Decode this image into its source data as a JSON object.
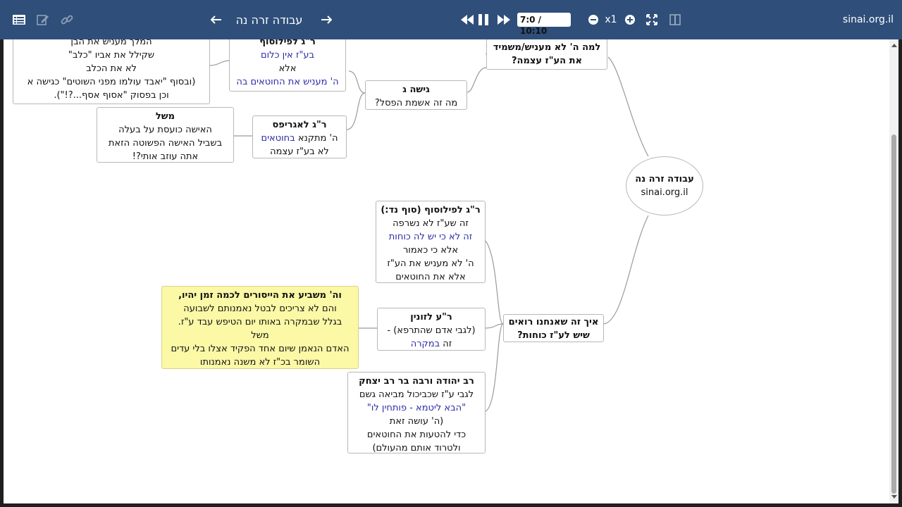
{
  "toolbar": {
    "title": "עבודה זרה נה",
    "time": "7:0 / 10:10",
    "speed": "x1",
    "site": "sinai.org.il",
    "icons": [
      "list-icon",
      "edit-icon",
      "link-icon",
      "arrow-left-icon",
      "arrow-right-icon",
      "rewind-icon",
      "pause-icon",
      "fast-forward-icon",
      "minus-icon",
      "plus-icon",
      "fullscreen-icon",
      "split-view-icon"
    ]
  },
  "colors": {
    "toolbar_bg": "#2f4f7a",
    "link_text": "#2b2ba8",
    "highlight_bg": "#fbf8a6"
  },
  "map": {
    "root": {
      "title": "עבודה זרה נה",
      "subtitle": "sinai.org.il"
    },
    "why_branch": {
      "title": "למה ה' לא מעניש/משמיד",
      "line2": "את הע\"ז עצמה?"
    },
    "approach_g": {
      "title": "גישה ג",
      "text": "מה זה אשמת הפסל?"
    },
    "philosopher_top": {
      "title": "ר\"ג לפילוסוף",
      "l1": "בע\"ז אין כלום",
      "l2": "אלא",
      "l3": "ה' מעניש את החוטאים בה"
    },
    "top_left": {
      "l1": "המלך מעניש את הבן",
      "l2": "שקילל את אביו \"כלב\"",
      "l3": "לא את הכלב",
      "l4": "(ובסוף \"יאבד עולמו מפני השוטים\" כגישה א",
      "l5": "וכן בפסוק \"אסוף אסף...?!\")."
    },
    "agrippas": {
      "title": "ר\"ג לאגריפס",
      "l1a": "ה' מתקנא",
      "l1b": "בחוטאים",
      "l2": "לא בע\"ז עצמה"
    },
    "mashal_top": {
      "title": "משל",
      "l1": "האישה כועסת על בעלה",
      "l2": "בשביל האישה הפשוטה הזאת",
      "l3": "אתה עוזב אותי?!"
    },
    "powers_branch": {
      "title": "איך זה שאנחנו רואים",
      "line2": "שיש לע\"ז כוחות?"
    },
    "philosopher_end": {
      "title": "ר\"ג לפילוסוף (סוף נד:)",
      "l1": "זה שע\"ז לא נשרפה",
      "l2": "זה לא כי יש לה כוחות",
      "l3": "אלא כי כאמור",
      "l4": "ה' לא מעניש את הע\"ז",
      "l5": "אלא את החוטאים"
    },
    "zunin": {
      "title": "ר\"ע לזונין",
      "l1": "(לגבי אדם שהתרפא) -",
      "l2a": "זה",
      "l2b": "במקרה"
    },
    "oath_note": {
      "title": "וה' משביע את הייסורים לכמה זמן יהיו,",
      "l1": "והם לא צריכים לבטל נאמנותם לשבועה",
      "l2": "בגלל שבמקרה באותו יום הטיפש עבד ע\"ז.",
      "l3": "משל",
      "l4": "האדם הנאמן שיום אחד הפקיד אצלו בלי עדים",
      "l5": "השומר בכ\"ז לא משנה נאמנותו"
    },
    "rav_yehuda": {
      "title": "רב יהודה ורבה בר רב יצחק",
      "l1": "לגבי ע\"ז שכביכול מביאה גשם",
      "l2": "\"הבא ליטמא - פותחין לו\"",
      "l3": "(ה' עושה זאת",
      "l4": "כדי להטעות את החוטאים",
      "l5": "ולטרוד אותם מהעולם)"
    }
  }
}
